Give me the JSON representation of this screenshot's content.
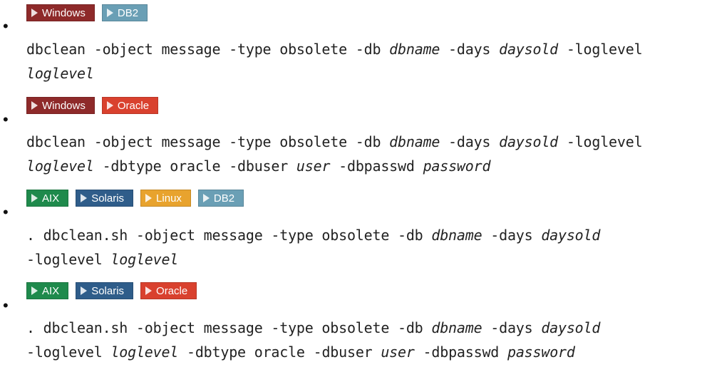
{
  "colors": {
    "windows": "#8e2a2a",
    "db2": "#6a9fb5",
    "oracle": "#d9412e",
    "aix": "#1f8a4c",
    "solaris": "#2f5d8a",
    "linux": "#e8a32e"
  },
  "items": [
    {
      "badges": [
        {
          "label": "Windows",
          "key": "windows"
        },
        {
          "label": "DB2",
          "key": "db2"
        }
      ],
      "segments": [
        [
          "dbclean -object message -type obsolete -db ",
          false
        ],
        [
          "dbname",
          true
        ],
        [
          " -days ",
          false
        ],
        [
          "daysold",
          true
        ],
        [
          " -loglevel\n",
          false
        ],
        [
          "loglevel",
          true
        ]
      ]
    },
    {
      "badges": [
        {
          "label": "Windows",
          "key": "windows"
        },
        {
          "label": "Oracle",
          "key": "oracle"
        }
      ],
      "segments": [
        [
          "dbclean -object message -type obsolete -db ",
          false
        ],
        [
          "dbname",
          true
        ],
        [
          " -days ",
          false
        ],
        [
          "daysold",
          true
        ],
        [
          " -loglevel\n",
          false
        ],
        [
          "loglevel",
          true
        ],
        [
          " -dbtype oracle -dbuser ",
          false
        ],
        [
          "user",
          true
        ],
        [
          " -dbpasswd ",
          false
        ],
        [
          "password",
          true
        ]
      ]
    },
    {
      "badges": [
        {
          "label": "AIX",
          "key": "aix"
        },
        {
          "label": "Solaris",
          "key": "solaris"
        },
        {
          "label": "Linux",
          "key": "linux"
        },
        {
          "label": "DB2",
          "key": "db2"
        }
      ],
      "segments": [
        [
          ". dbclean.sh -object message -type obsolete -db ",
          false
        ],
        [
          "dbname",
          true
        ],
        [
          " -days ",
          false
        ],
        [
          "daysold",
          true
        ],
        [
          "\n-loglevel ",
          false
        ],
        [
          "loglevel",
          true
        ]
      ]
    },
    {
      "badges": [
        {
          "label": "AIX",
          "key": "aix"
        },
        {
          "label": "Solaris",
          "key": "solaris"
        },
        {
          "label": "Oracle",
          "key": "oracle"
        }
      ],
      "segments": [
        [
          ". dbclean.sh -object message -type obsolete -db ",
          false
        ],
        [
          "dbname",
          true
        ],
        [
          " -days ",
          false
        ],
        [
          "daysold",
          true
        ],
        [
          "\n-loglevel ",
          false
        ],
        [
          "loglevel",
          true
        ],
        [
          " -dbtype oracle -dbuser ",
          false
        ],
        [
          "user",
          true
        ],
        [
          " -dbpasswd ",
          false
        ],
        [
          "password",
          true
        ]
      ]
    }
  ]
}
